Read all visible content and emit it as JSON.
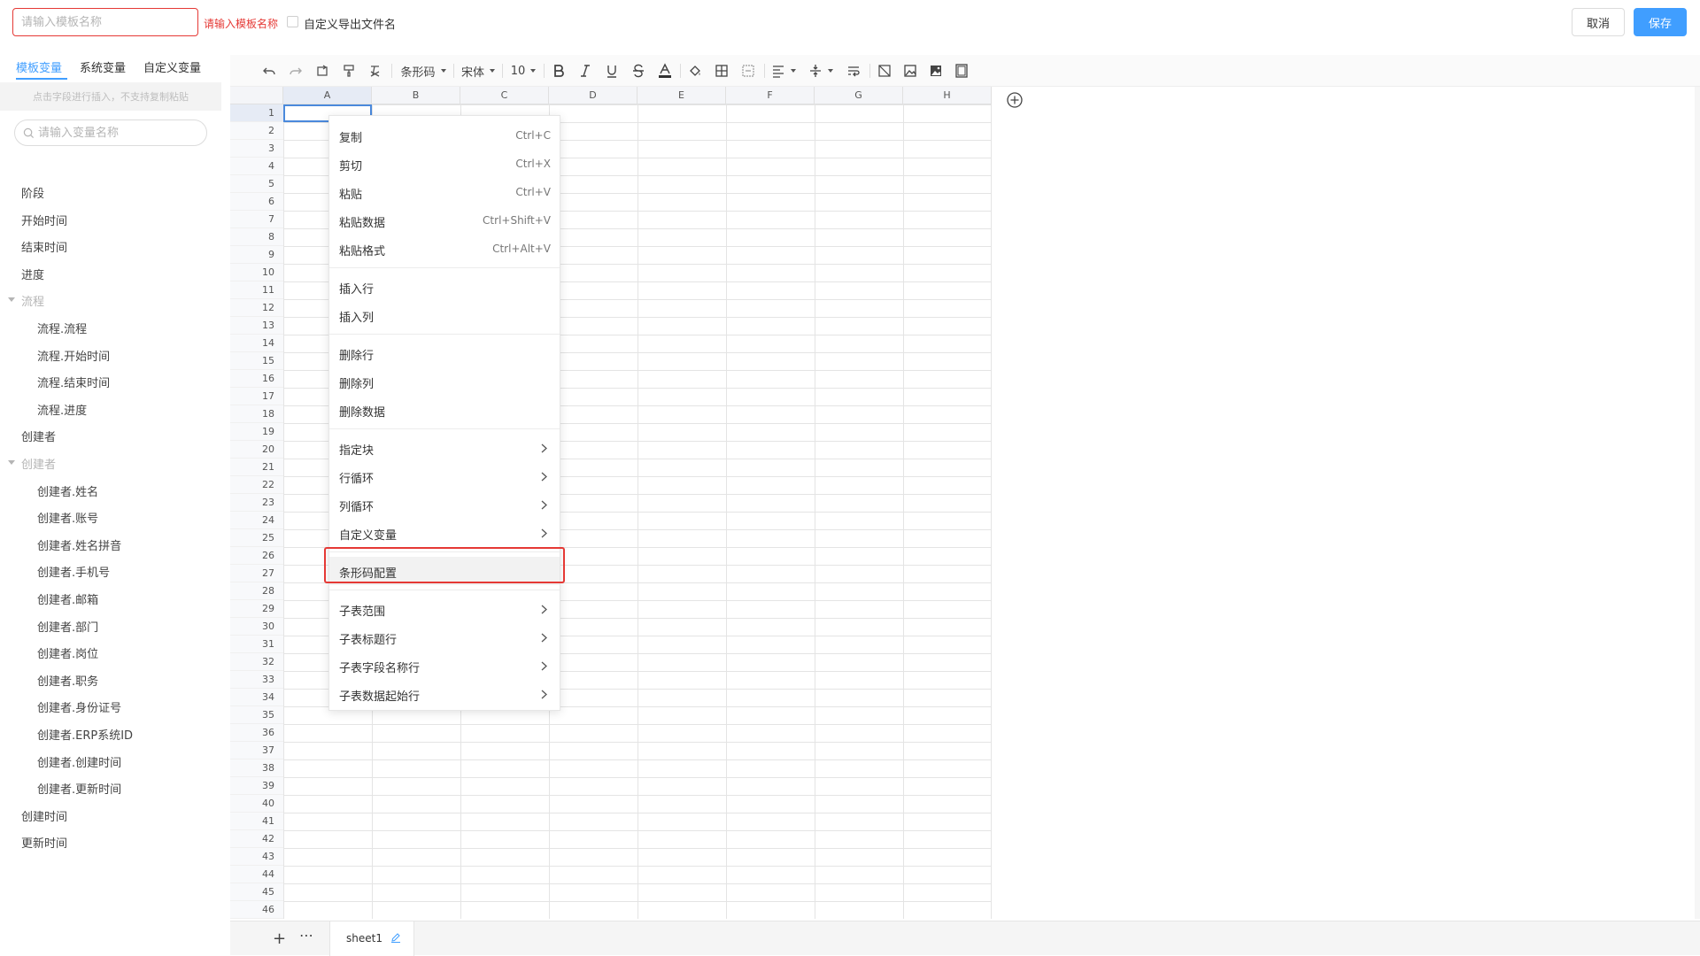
{
  "header": {
    "name_placeholder": "请输入模板名称",
    "name_error": "请输入模板名称",
    "custom_filename_label": "自定义导出文件名",
    "cancel_label": "取消",
    "save_label": "保存"
  },
  "sidebar": {
    "tabs": [
      "模板变量",
      "系统变量",
      "自定义变量"
    ],
    "hint": "点击字段进行插入，不支持复制粘贴",
    "search_placeholder": "请输入变量名称",
    "items": [
      {
        "label": "阶段",
        "kind": "item"
      },
      {
        "label": "开始时间",
        "kind": "item"
      },
      {
        "label": "结束时间",
        "kind": "item"
      },
      {
        "label": "进度",
        "kind": "item"
      },
      {
        "label": "流程",
        "kind": "group"
      },
      {
        "label": "流程.流程",
        "kind": "child"
      },
      {
        "label": "流程.开始时间",
        "kind": "child"
      },
      {
        "label": "流程.结束时间",
        "kind": "child"
      },
      {
        "label": "流程.进度",
        "kind": "child"
      },
      {
        "label": "创建者",
        "kind": "item"
      },
      {
        "label": "创建者",
        "kind": "group"
      },
      {
        "label": "创建者.姓名",
        "kind": "child"
      },
      {
        "label": "创建者.账号",
        "kind": "child"
      },
      {
        "label": "创建者.姓名拼音",
        "kind": "child"
      },
      {
        "label": "创建者.手机号",
        "kind": "child"
      },
      {
        "label": "创建者.邮箱",
        "kind": "child"
      },
      {
        "label": "创建者.部门",
        "kind": "child"
      },
      {
        "label": "创建者.岗位",
        "kind": "child"
      },
      {
        "label": "创建者.职务",
        "kind": "child"
      },
      {
        "label": "创建者.身份证号",
        "kind": "child"
      },
      {
        "label": "创建者.ERP系统ID",
        "kind": "child"
      },
      {
        "label": "创建者.创建时间",
        "kind": "child"
      },
      {
        "label": "创建者.更新时间",
        "kind": "child"
      },
      {
        "label": "创建时间",
        "kind": "item"
      },
      {
        "label": "更新时间",
        "kind": "item"
      }
    ]
  },
  "toolbar": {
    "barcode_label": "条形码",
    "font_label": "宋体",
    "font_size": "10"
  },
  "sheet": {
    "columns": [
      "A",
      "B",
      "C",
      "D",
      "E",
      "F",
      "G",
      "H"
    ],
    "row_count": 46,
    "selected_cell": "A1",
    "tab_name": "sheet1",
    "add_label": "+",
    "more_label": "⋯"
  },
  "context_menu": {
    "groups": [
      [
        {
          "label": "复制",
          "shortcut": "Ctrl+C"
        },
        {
          "label": "剪切",
          "shortcut": "Ctrl+X"
        },
        {
          "label": "粘贴",
          "shortcut": "Ctrl+V"
        },
        {
          "label": "粘贴数据",
          "shortcut": "Ctrl+Shift+V"
        },
        {
          "label": "粘贴格式",
          "shortcut": "Ctrl+Alt+V"
        }
      ],
      [
        {
          "label": "插入行",
          "shortcut": ""
        },
        {
          "label": "插入列",
          "shortcut": ""
        }
      ],
      [
        {
          "label": "删除行",
          "shortcut": ""
        },
        {
          "label": "删除列",
          "shortcut": ""
        },
        {
          "label": "删除数据",
          "shortcut": ""
        }
      ],
      [
        {
          "label": "指定块",
          "submenu": true
        },
        {
          "label": "行循环",
          "submenu": true
        },
        {
          "label": "列循环",
          "submenu": true
        },
        {
          "label": "自定义变量",
          "submenu": true
        }
      ],
      [
        {
          "label": "条形码配置",
          "highlighted": true
        }
      ],
      [
        {
          "label": "子表范围",
          "submenu": true
        },
        {
          "label": "子表标题行",
          "submenu": true
        },
        {
          "label": "子表字段名称行",
          "submenu": true
        },
        {
          "label": "子表数据起始行",
          "submenu": true
        }
      ]
    ]
  },
  "colors": {
    "accent": "#409eff",
    "error": "#e53935",
    "selection": "#4a89dc"
  }
}
